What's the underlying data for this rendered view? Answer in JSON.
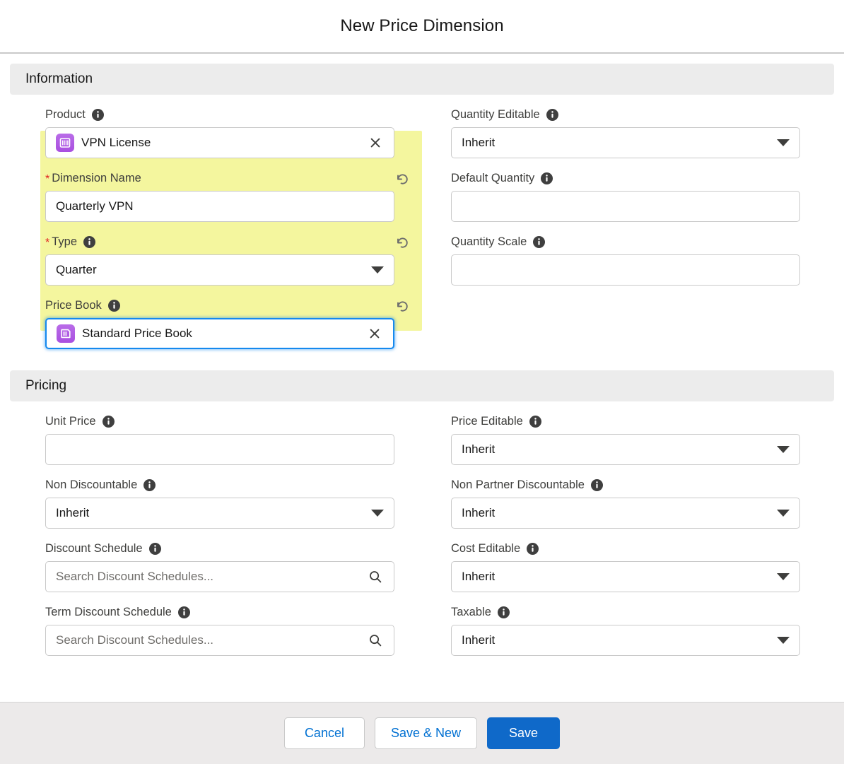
{
  "modal": {
    "title": "New Price Dimension"
  },
  "sections": [
    {
      "id": "information",
      "title": "Information"
    },
    {
      "id": "pricing",
      "title": "Pricing"
    }
  ],
  "information": {
    "left": [
      {
        "label": "Product",
        "required": false,
        "highlighted": false,
        "focused": false,
        "control": "lookup-pill",
        "value": "VPN License",
        "icon": "product-record-icon",
        "trailing": "clear-icon"
      },
      {
        "label": "Dimension Name",
        "required": true,
        "highlighted": true,
        "focused": false,
        "control": "text",
        "value": "Quarterly VPN",
        "placeholder": "",
        "trailing": "none"
      },
      {
        "label": "Type",
        "required": true,
        "highlighted": true,
        "focused": false,
        "control": "select",
        "value": "Quarter",
        "trailing": "chevron-down-icon"
      },
      {
        "label": "Price Book",
        "required": false,
        "highlighted": true,
        "focused": true,
        "control": "lookup-pill",
        "value": "Standard Price Book",
        "icon": "price-book-record-icon",
        "trailing": "clear-icon"
      }
    ],
    "right": [
      {
        "label": "Quantity Editable",
        "required": false,
        "control": "select",
        "value": "Inherit",
        "trailing": "chevron-down-icon"
      },
      {
        "label": "Default Quantity",
        "required": false,
        "control": "text",
        "value": "",
        "placeholder": "",
        "trailing": "none"
      },
      {
        "label": "Quantity Scale",
        "required": false,
        "control": "text",
        "value": "",
        "placeholder": "",
        "trailing": "none"
      }
    ]
  },
  "pricing": {
    "left": [
      {
        "label": "Unit Price",
        "required": false,
        "control": "text",
        "value": "",
        "placeholder": "",
        "trailing": "none"
      },
      {
        "label": "Non Discountable",
        "required": false,
        "control": "select",
        "value": "Inherit",
        "trailing": "chevron-down-icon"
      },
      {
        "label": "Discount Schedule",
        "required": false,
        "control": "search",
        "value": "",
        "placeholder": "Search Discount Schedules...",
        "trailing": "search-icon"
      },
      {
        "label": "Term Discount Schedule",
        "required": false,
        "control": "search",
        "value": "",
        "placeholder": "Search Discount Schedules...",
        "trailing": "search-icon"
      }
    ],
    "right": [
      {
        "label": "Price Editable",
        "required": false,
        "control": "select",
        "value": "Inherit",
        "trailing": "chevron-down-icon"
      },
      {
        "label": "Non Partner Discountable",
        "required": false,
        "control": "select",
        "value": "Inherit",
        "trailing": "chevron-down-icon"
      },
      {
        "label": "Cost Editable",
        "required": false,
        "control": "select",
        "value": "Inherit",
        "trailing": "chevron-down-icon"
      },
      {
        "label": "Taxable",
        "required": false,
        "control": "select",
        "value": "Inherit",
        "trailing": "chevron-down-icon"
      }
    ]
  },
  "footer": {
    "cancel_label": "Cancel",
    "save_new_label": "Save & New",
    "save_label": "Save"
  },
  "colors": {
    "highlight_yellow": "#f4f69e",
    "focus_blue": "#1589ee",
    "brand_blue": "#0f69c9",
    "link_blue": "#0070d2",
    "record_icon_purple": "#a94fe0",
    "required_red": "#e02020",
    "section_header_gray": "#ececec",
    "footer_gray": "#eceaea"
  }
}
